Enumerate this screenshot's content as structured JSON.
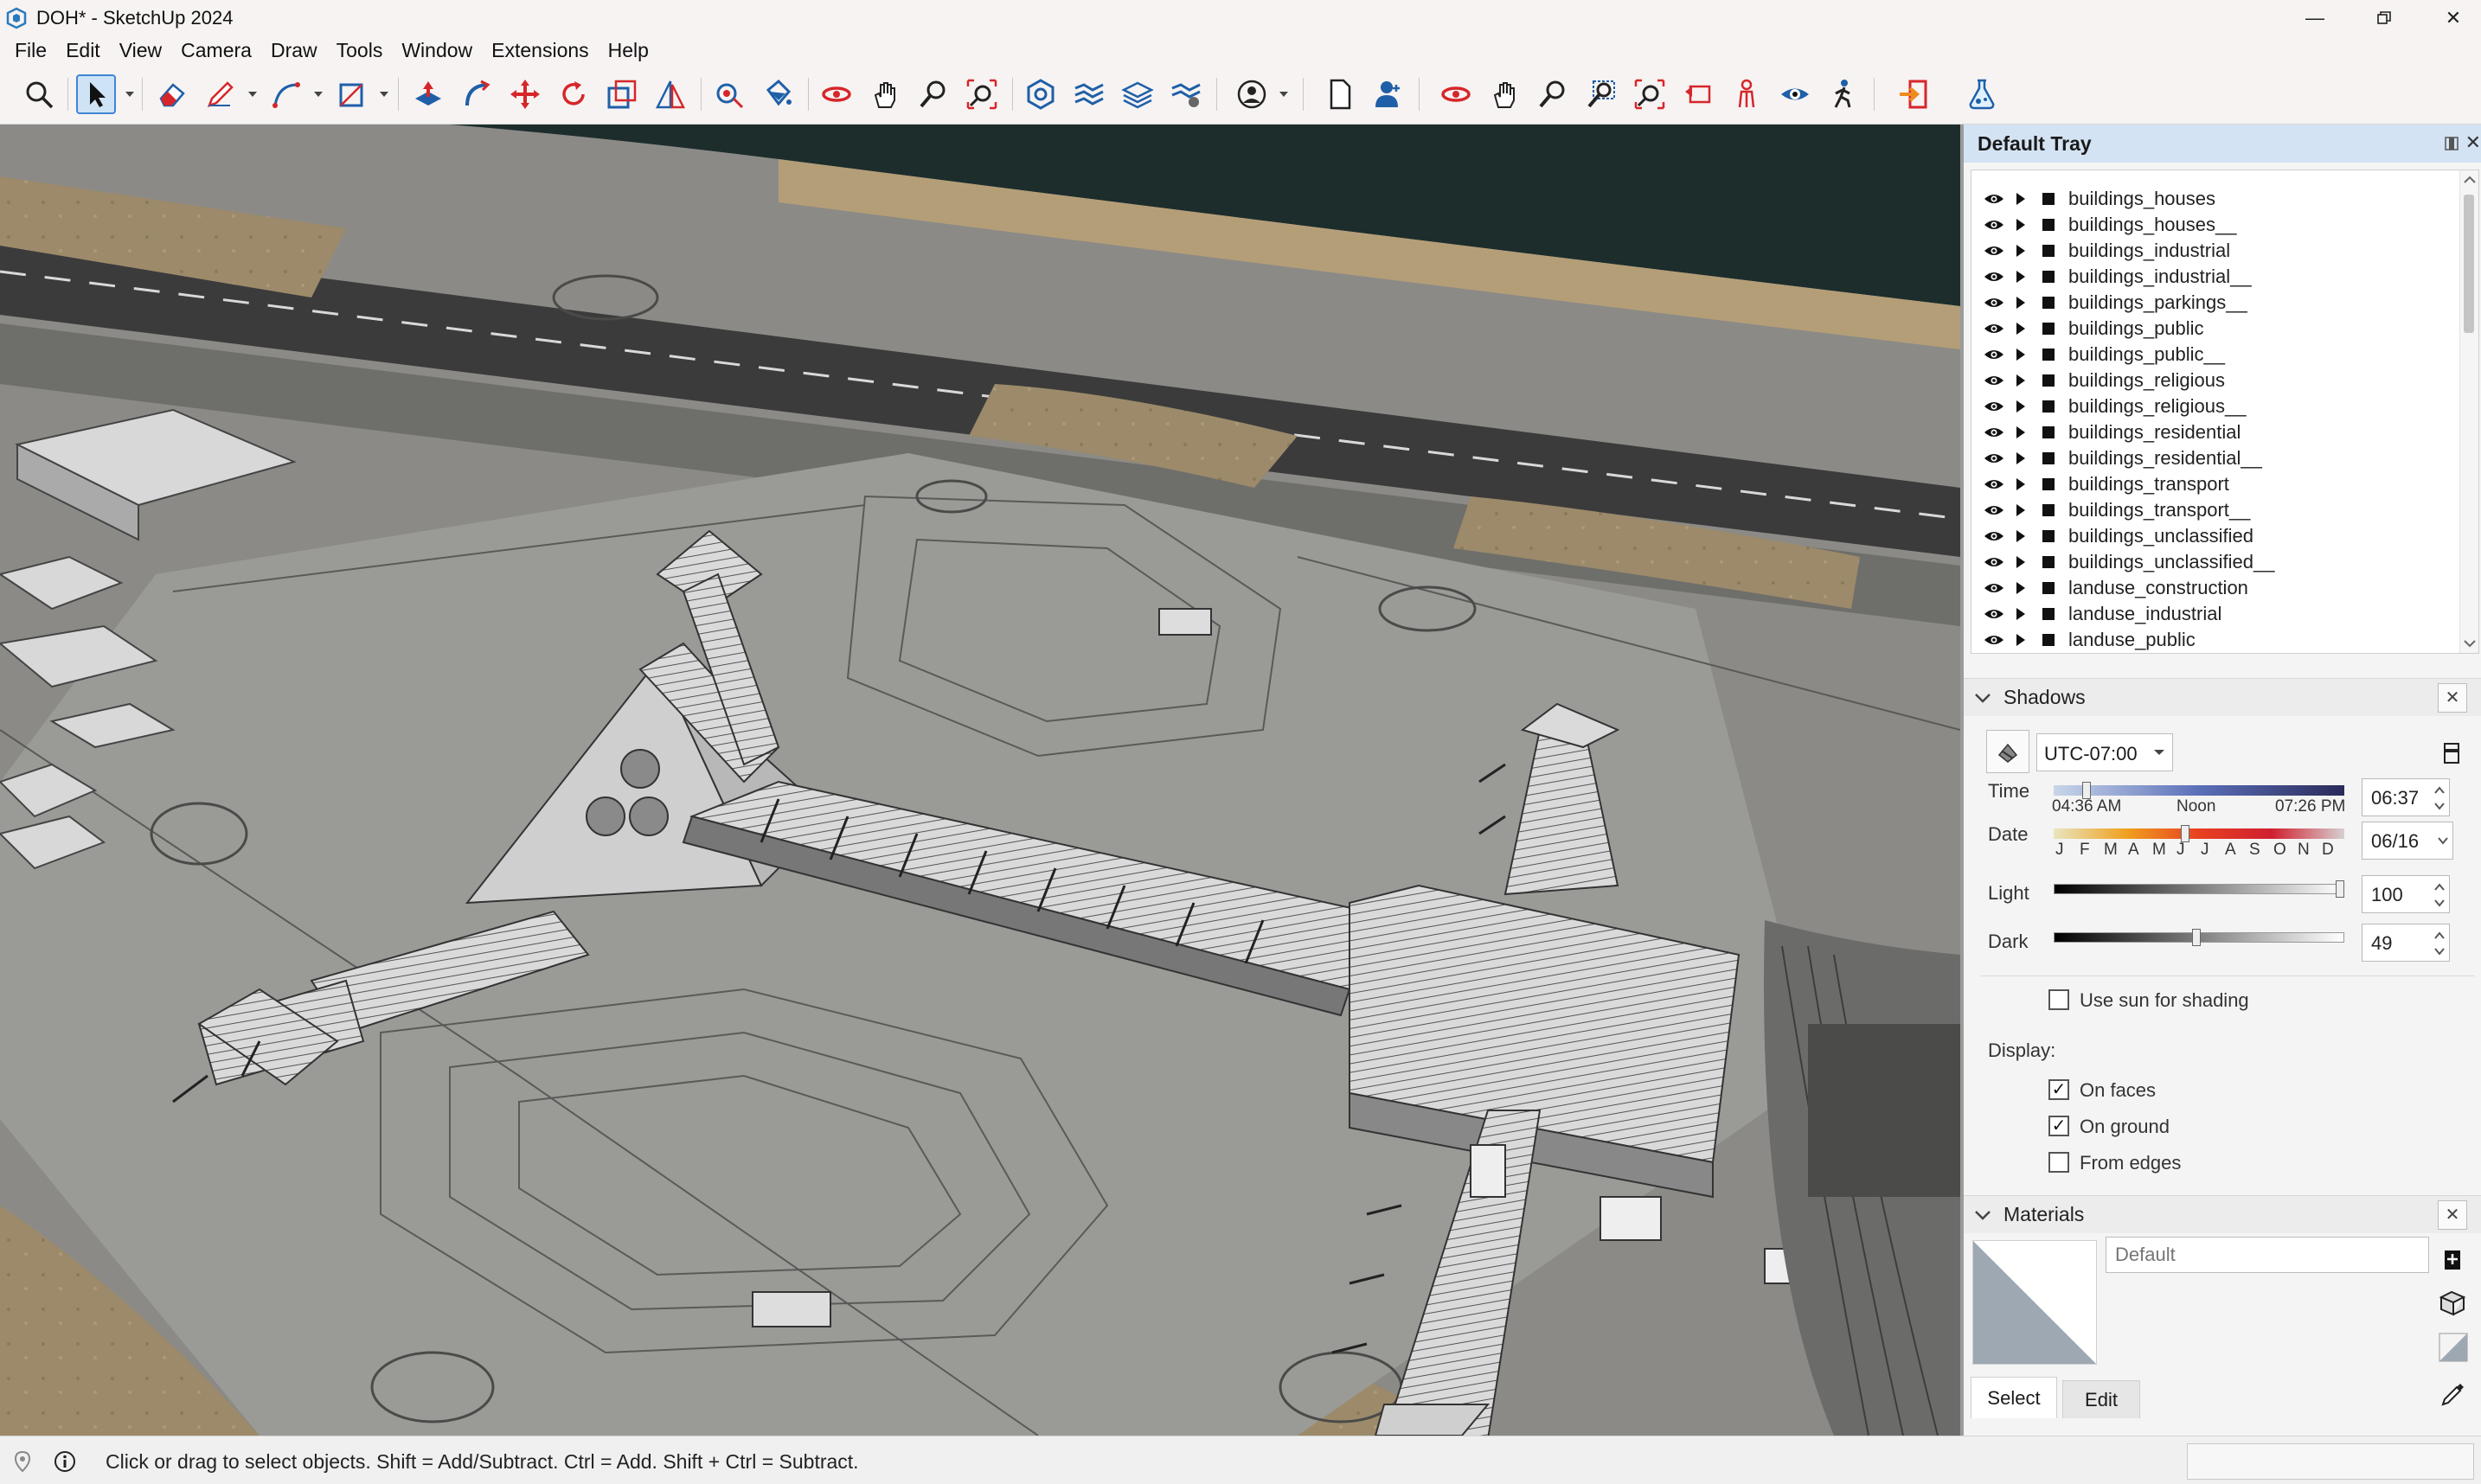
{
  "window": {
    "title": "DOH* - SketchUp 2024",
    "controls": [
      "minimize",
      "maximize",
      "close"
    ]
  },
  "menu": [
    "File",
    "Edit",
    "View",
    "Camera",
    "Draw",
    "Tools",
    "Window",
    "Extensions",
    "Help"
  ],
  "toolbar": {
    "tools": [
      "search-icon",
      "select-icon",
      "eraser-icon",
      "pencil-icon",
      "arc-icon",
      "rectangle-icon",
      "push-pull-icon",
      "follow-me-icon",
      "move-icon",
      "rotate-icon",
      "scale-icon",
      "offset-icon",
      "tape-measure-icon",
      "paint-bucket-icon",
      "orbit-icon",
      "pan-icon",
      "zoom-icon",
      "zoom-extents-icon",
      "geo-location-icon",
      "terrain-icon",
      "layers-icon",
      "section-icon",
      "account-icon",
      "new-document-icon",
      "user-icon",
      "orbit-2-icon",
      "pan-2-icon",
      "zoom-2-icon",
      "zoom-window-icon",
      "zoom-extents-2-icon",
      "previous-view-icon",
      "position-camera-icon",
      "look-around-icon",
      "walk-icon",
      "exit-icon",
      "extension-flask-icon"
    ]
  },
  "tray": {
    "title": "Default Tray",
    "outliner": {
      "items": [
        "buildings_houses",
        "buildings_houses__",
        "buildings_industrial",
        "buildings_industrial__",
        "buildings_parkings__",
        "buildings_public",
        "buildings_public__",
        "buildings_religious",
        "buildings_religious__",
        "buildings_residential",
        "buildings_residential__",
        "buildings_transport",
        "buildings_transport__",
        "buildings_unclassified",
        "buildings_unclassified__",
        "landuse_construction",
        "landuse_industrial",
        "landuse_public"
      ]
    },
    "shadows": {
      "title": "Shadows",
      "timezone": "UTC-07:00",
      "time_label": "Time",
      "time_value": "06:37",
      "time_start": "04:36 AM",
      "time_mid": "Noon",
      "time_end": "07:26 PM",
      "date_label": "Date",
      "date_value": "06/16",
      "months": [
        "J",
        "F",
        "M",
        "A",
        "M",
        "J",
        "J",
        "A",
        "S",
        "O",
        "N",
        "D"
      ],
      "light_label": "Light",
      "light_value": "100",
      "dark_label": "Dark",
      "dark_value": "49",
      "use_sun_label": "Use sun for shading",
      "use_sun_checked": false,
      "display_label": "Display:",
      "on_faces_label": "On faces",
      "on_faces_checked": true,
      "on_ground_label": "On ground",
      "on_ground_checked": true,
      "from_edges_label": "From edges",
      "from_edges_checked": false,
      "time_slider_fraction": 0.1,
      "date_slider_fraction": 0.45,
      "light_slider_fraction": 1.0,
      "dark_slider_fraction": 0.49
    },
    "materials": {
      "title": "Materials",
      "material_name_placeholder": "Default",
      "tab_select": "Select",
      "tab_edit": "Edit"
    }
  },
  "statusbar": {
    "message": "Click or drag to select objects. Shift = Add/Subtract. Ctrl = Add. Shift + Ctrl = Subtract."
  },
  "colors": {
    "tray_header": "#d3e3f3",
    "accent_selection": "#3f86d4",
    "icon_red": "#d6262a",
    "icon_blue": "#1f5fa8",
    "terrain_sand": "#a08d6c",
    "terrain_concrete": "#8e8e8a",
    "sea": "#1c2d2c"
  }
}
